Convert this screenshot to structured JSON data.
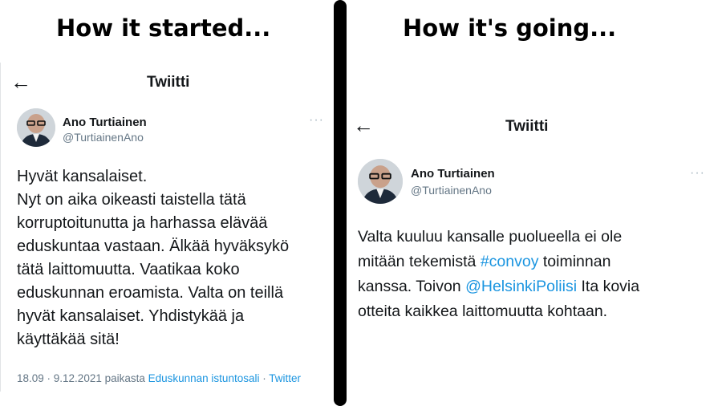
{
  "captions": {
    "left": "How it started...",
    "right": "How it's going..."
  },
  "left_tweet": {
    "header_title": "Twiitti",
    "author_name": "Ano Turtiainen",
    "author_handle": "@TurtiainenAno",
    "lines": [
      "Hyvät kansalaiset.",
      "Nyt on aika oikeasti taistella tätä",
      "korruptoitunutta ja harhassa elävää",
      "eduskuntaa vastaan. Älkää hyväksykö",
      "tätä laittomuutta. Vaatikaa koko",
      "eduskunnan eroamista. Valta on teillä",
      "hyvät kansalaiset. Yhdistykää ja",
      "käyttäkää sitä!"
    ],
    "meta_time": "18.09 · 9.12.2021 paikasta ",
    "meta_place": "Eduskunnan istuntosali",
    "meta_sep": " · ",
    "meta_source": "Twitter"
  },
  "right_tweet": {
    "header_title": "Twiitti",
    "author_name": "Ano Turtiainen",
    "author_handle": "@TurtiainenAno",
    "line1": "Valta kuuluu kansalle puolueella ei ole",
    "line2_pre": "mitään tekemistä ",
    "line2_hashtag": "#convoy",
    "line2_post": " toiminnan",
    "line3_pre": "kanssa. Toivon ",
    "line3_mention": "@HelsinkiPoliisi",
    "line3_post": " Ita kovia",
    "line4": "otteita kaikkea laittomuutta kohtaan."
  },
  "icons": {
    "back": "back-arrow-icon",
    "more": "more-options-icon",
    "avatar": "profile-photo"
  },
  "colors": {
    "link": "#1b95e0",
    "secondary_text": "#657786",
    "divider": "#000000"
  }
}
